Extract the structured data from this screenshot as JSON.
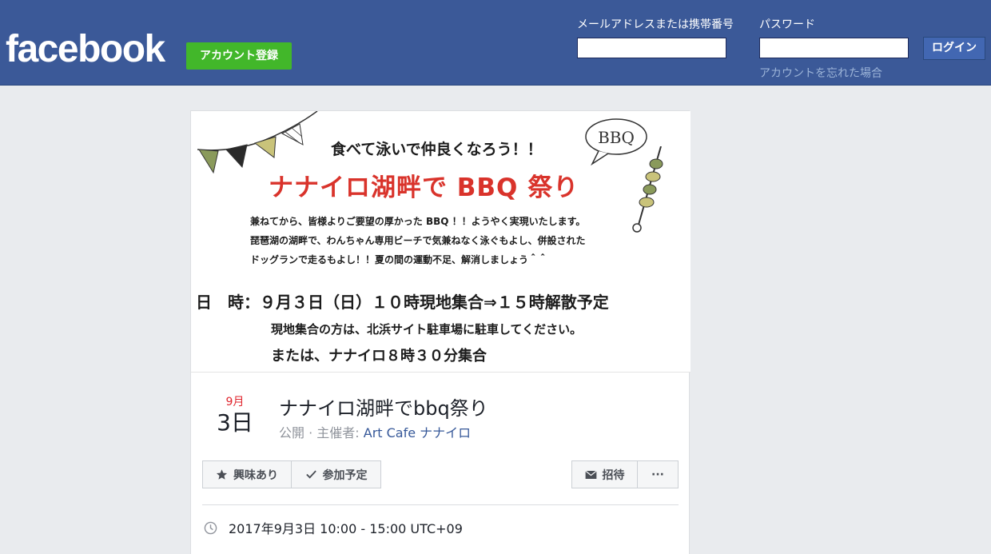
{
  "header": {
    "logo": "facebook",
    "signup_label": "アカウント登録",
    "email_label": "メールアドレスまたは携帯番号",
    "password_label": "パスワード",
    "login_label": "ログイン",
    "forgot_label": "アカウントを忘れた場合",
    "brand_color": "#3b5998",
    "signup_color": "#42b72a"
  },
  "banner": {
    "tagline": "食べて泳いで仲良くなろう！！",
    "headline": "ナナイロ湖畔で BBQ 祭り",
    "bubble": "BBQ",
    "body_lines": [
      "兼ねてから、皆様よりご要望の厚かった BBQ ！！ようやく実現いたします。",
      "琵琶湖の湖畔で、わんちゃん専用ビーチで気兼ねなく泳ぐもよし、併設された",
      "ドッグランで走るもよし！！夏の間の運動不足、解消しましょう＾＾"
    ],
    "schedule": "日　時：９月３日（日）１０時現地集合⇒１５時解散予定",
    "note_1": "現地集合の方は、北浜サイト駐車場に駐車してください。",
    "note_2": "または、ナナイロ８時３０分集合",
    "headline_color": "#d9332b"
  },
  "event": {
    "month": "9月",
    "day": "3日",
    "title": "ナナイロ湖畔でbbq祭り",
    "privacy": "公開 · 主催者: ",
    "host": "Art Cafe ナナイロ",
    "datetime": "2017年9月3日 10:00 - 15:00 UTC+09"
  },
  "actions": {
    "interested": "興味あり",
    "going": "参加予定",
    "invite": "招待",
    "more": "···"
  },
  "icons": {
    "interested": "star-icon",
    "going": "check-icon",
    "invite": "envelope-icon",
    "time": "clock-icon"
  }
}
